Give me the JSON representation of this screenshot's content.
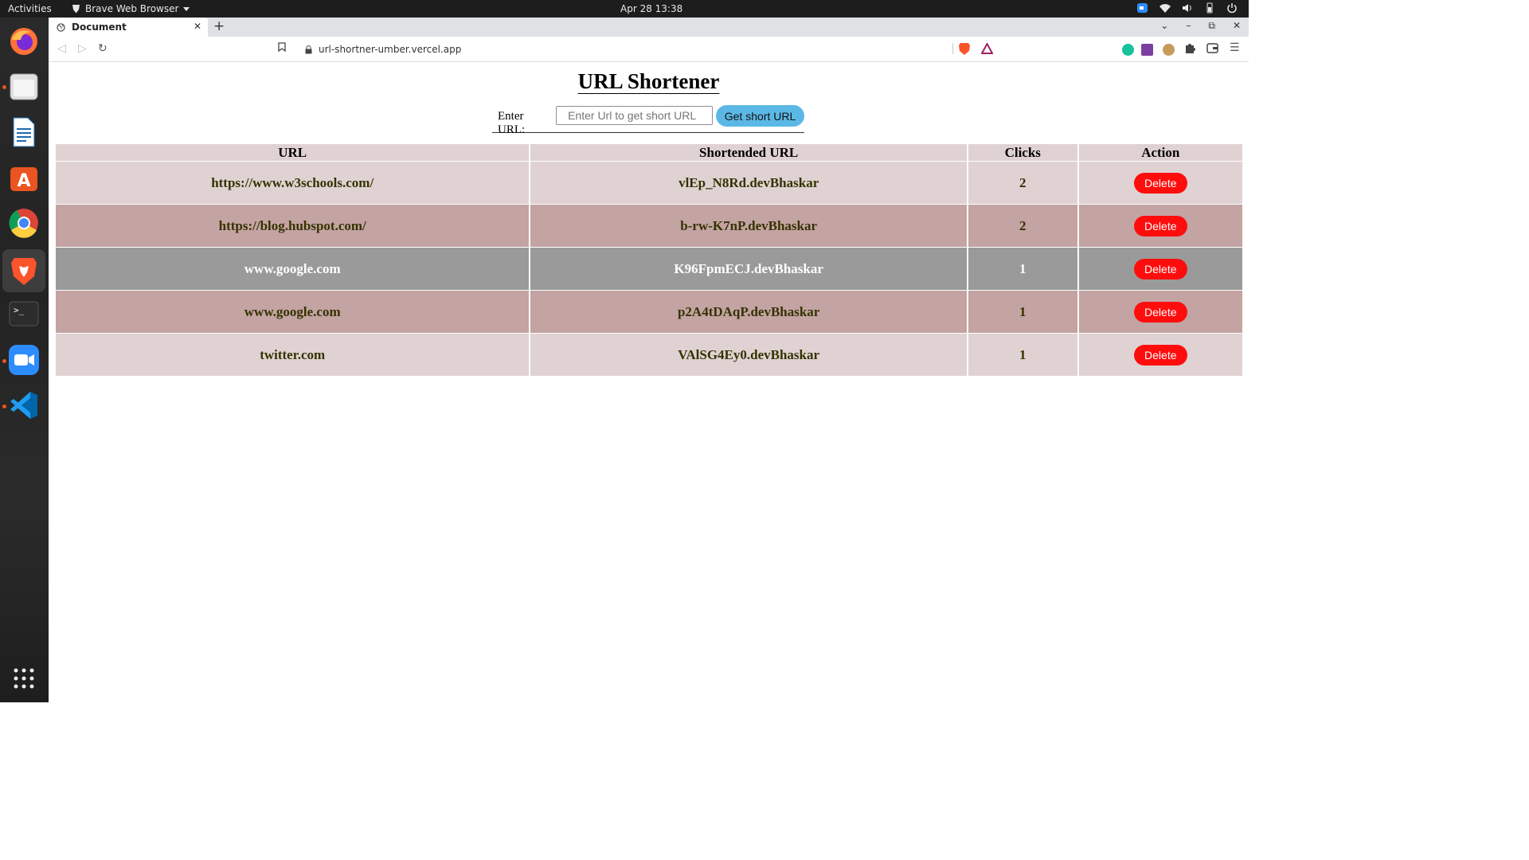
{
  "system": {
    "activities_label": "Activities",
    "app_name": "Brave Web Browser",
    "datetime": "Apr 28  13:38"
  },
  "browser": {
    "tab_title": "Document",
    "url": "url-shortner-umber.vercel.app"
  },
  "page": {
    "heading": "URL Shortener",
    "form": {
      "label": "Enter URL:",
      "placeholder": "Enter Url to get short URL",
      "submit_label": "Get short URL"
    },
    "table": {
      "headers": [
        "URL",
        "Shortended URL",
        "Clicks",
        "Action"
      ],
      "rows": [
        {
          "url": "https://www.w3schools.com/",
          "short": "vlEp_N8Rd.devBhaskar",
          "clicks": "2",
          "action": "Delete"
        },
        {
          "url": "https://blog.hubspot.com/",
          "short": "b-rw-K7nP.devBhaskar",
          "clicks": "2",
          "action": "Delete"
        },
        {
          "url": "www.google.com",
          "short": "K96FpmECJ.devBhaskar",
          "clicks": "1",
          "action": "Delete"
        },
        {
          "url": "www.google.com",
          "short": "p2A4tDAqP.devBhaskar",
          "clicks": "1",
          "action": "Delete"
        },
        {
          "url": "twitter.com",
          "short": "VAlSG4Ey0.devBhaskar",
          "clicks": "1",
          "action": "Delete"
        }
      ]
    }
  },
  "colors": {
    "row_light": "#e0d2d3",
    "row_mid": "#c4a3a3",
    "row_dark": "#9a9a9a",
    "submit_button": "#5bb8e6",
    "delete_button": "#ff0d0d"
  },
  "dock_icons": [
    "firefox-icon",
    "files-icon",
    "writer-icon",
    "app-center-icon",
    "chrome-icon",
    "brave-icon",
    "terminal-icon",
    "zoom-icon",
    "vscode-icon",
    "show-apps-icon"
  ]
}
